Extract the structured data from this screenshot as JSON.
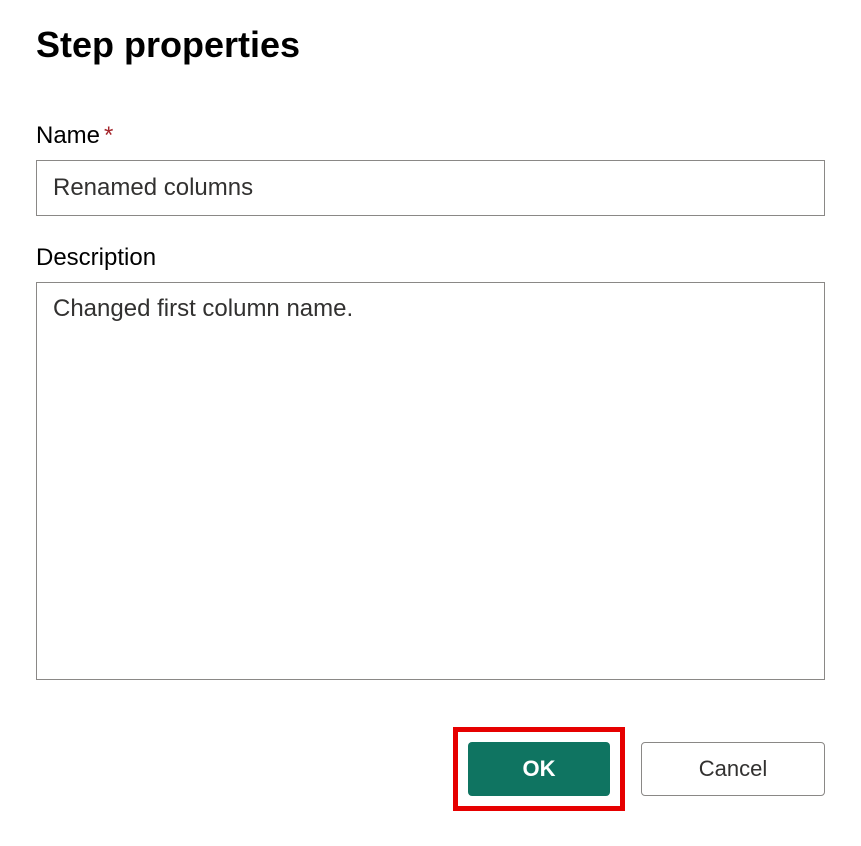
{
  "dialog": {
    "title": "Step properties"
  },
  "fields": {
    "name": {
      "label": "Name",
      "required_marker": "*",
      "value": "Renamed columns"
    },
    "description": {
      "label": "Description",
      "value": "Changed first column name."
    }
  },
  "buttons": {
    "ok": "OK",
    "cancel": "Cancel"
  },
  "colors": {
    "primary": "#0f7461",
    "highlight_border": "#e60000",
    "required": "#a4262c"
  }
}
